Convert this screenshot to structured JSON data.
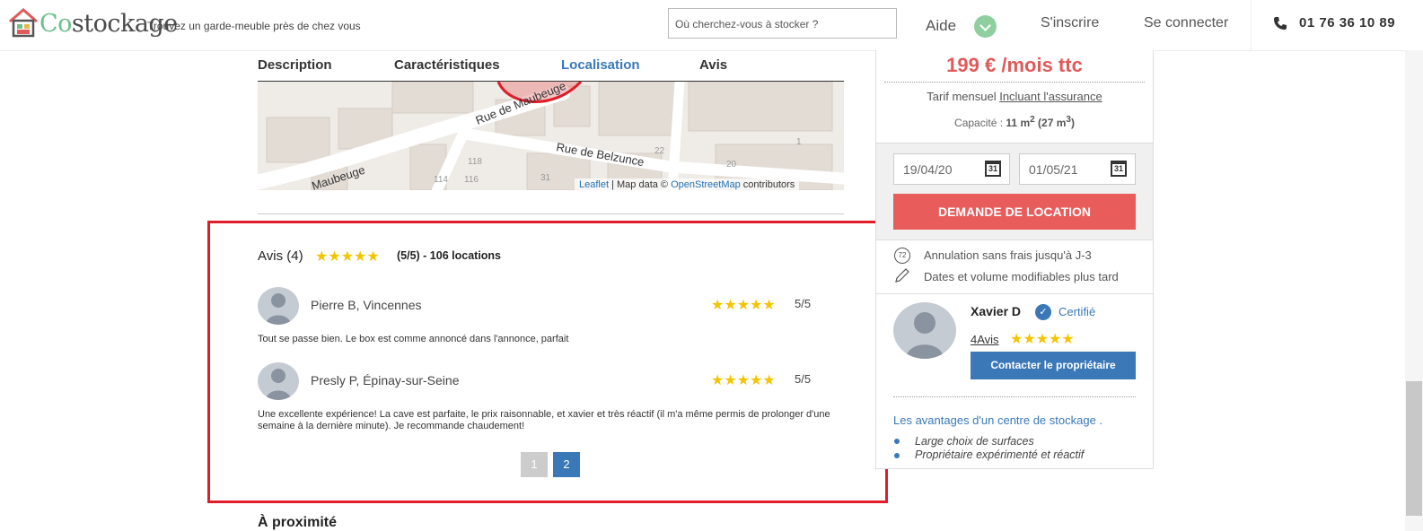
{
  "header": {
    "logo": {
      "prefix": "Co",
      "suffix": "stockage"
    },
    "tagline": "Trouvez un garde-meuble près de chez vous",
    "search_placeholder": "Où cherchez-vous à stocker ?",
    "aide": "Aide",
    "signup": "S'inscrire",
    "login": "Se connecter",
    "phone": "01 76 36 10 89"
  },
  "tabs": [
    "Description",
    "Caractéristiques",
    "Localisation",
    "Avis"
  ],
  "active_tab": "Localisation",
  "map": {
    "streets": [
      "Rue de Maubeuge",
      "Rue de Belzunce",
      "Maubeuge"
    ],
    "house_numbers": [
      "22",
      "20",
      "118",
      "116",
      "114",
      "1",
      "31"
    ],
    "attribution": {
      "leaflet": "Leaflet",
      "mid": " | Map data © ",
      "osm": "OpenStreetMap",
      "end": " contributors"
    }
  },
  "reviews": {
    "title": "Avis (4)",
    "rating": 5,
    "summary": "(5/5) - 106 locations",
    "items": [
      {
        "author": "Pierre B, Vincennes",
        "rating": 5,
        "score": "5/5",
        "text": "Tout se passe bien. Le box est comme annoncé dans l'annonce, parfait"
      },
      {
        "author": "Presly P, Épinay-sur-Seine",
        "rating": 5,
        "score": "5/5",
        "text": "Une excellente expérience! La cave est parfaite, le prix raisonnable, et xavier et très réactif (il m'a même permis de prolonger d'une semaine à la dernière minute). Je recommande chaudement!"
      }
    ],
    "pages": [
      "1",
      "2"
    ],
    "current_page": "2"
  },
  "proximite_title": "À proximité",
  "booking": {
    "price": "199 € /mois ttc",
    "tarif_prefix": "Tarif mensuel ",
    "tarif_link": "Incluant l'assurance",
    "capacity_label": "Capacité : ",
    "capacity_m2": "11 m",
    "capacity_m3": "(27 m",
    "start_date": "19/04/20",
    "end_date": "01/05/21",
    "calendar_day": "31",
    "cta": "DEMANDE DE LOCATION",
    "features": [
      {
        "icon": "clock-72-icon",
        "badge": "72",
        "text": "Annulation sans frais jusqu'à J-3"
      },
      {
        "icon": "pencil-icon",
        "text": "Dates et volume modifiables plus tard"
      }
    ]
  },
  "owner": {
    "name": "Xavier D",
    "certified": "Certifié",
    "avis": "4Avis",
    "rating": 5,
    "contact": "Contacter le propriétaire"
  },
  "advantages": {
    "title": "Les avantages d'un centre de stockage .",
    "items": [
      "Large choix de surfaces",
      "Propriétaire expérimenté et réactif"
    ]
  },
  "colors": {
    "accent": "#3a78b8",
    "cta": "#e95c5c",
    "price": "#e05a5a",
    "highlight": "#e01e2a",
    "stars": "#f5c400"
  }
}
